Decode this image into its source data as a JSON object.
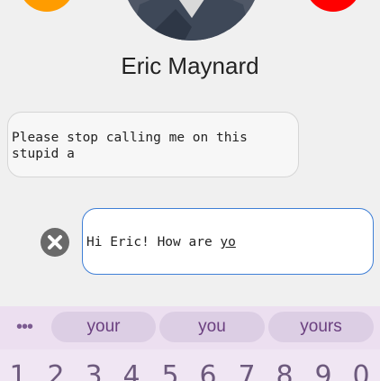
{
  "contact": {
    "name": "Eric Maynard"
  },
  "conversation": {
    "incoming_message": "Please stop calling me on this stupid a",
    "compose_prefix": "Hi Eric! How are ",
    "compose_underlined": "yo"
  },
  "suggestions": {
    "more_label": "•••",
    "items": [
      "your",
      "you",
      "yours"
    ]
  },
  "keyboard": {
    "number_row": [
      "1",
      "2",
      "3",
      "4",
      "5",
      "6",
      "7",
      "8",
      "9",
      "0"
    ]
  },
  "icons": {
    "left_call_button": "orange-circle-icon",
    "right_call_button": "red-circle-icon",
    "clear_button": "close-circle-icon"
  },
  "colors": {
    "accent_orange": "#ff9c00",
    "accent_red": "#ff0000",
    "compose_border": "#3f7fd6",
    "suggestion_bar": "#ecdff0",
    "chip_text": "#6a3f7f"
  }
}
